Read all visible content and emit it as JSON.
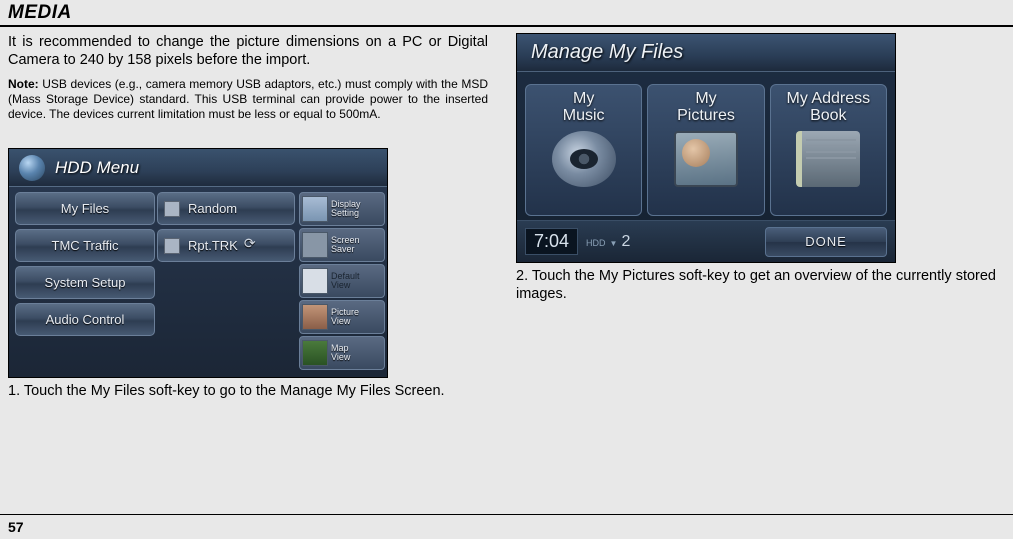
{
  "header": {
    "title": "MEDIA"
  },
  "col_left": {
    "intro": "It is recommended to change the picture dimensions on a PC or Digital Camera to 240 by 158 pixels before the import.",
    "note_label": "Note:",
    "note_body": " USB devices (e.g., camera memory USB adaptors, etc.) must comply with the MSD (Mass Storage Device) standard. This USB terminal can provide power to the inserted device. The devices current limitation must be less or equal to 500mA.",
    "caption": "1. Touch the My Files soft-key to go to the Manage My Files Screen."
  },
  "col_right": {
    "caption": "2. Touch the My Pictures soft-key to get an overview of the currently stored images."
  },
  "hdd_menu": {
    "title": "HDD Menu",
    "left_buttons": [
      "My Files",
      "TMC Traffic",
      "System Setup",
      "Audio Control"
    ],
    "mid_buttons": [
      "Random",
      "Rpt.TRK"
    ],
    "side_cards": [
      "Display\nSetting",
      "Screen\nSaver",
      "Default\nView",
      "Picture\nView",
      "Map\nView"
    ]
  },
  "manage_files": {
    "title": "Manage My Files",
    "cards": [
      "My\nMusic",
      "My\nPictures",
      "My Address\nBook"
    ],
    "clock": "7:04",
    "hdd_label": "HDD",
    "hdd_track": "2",
    "done": "DONE"
  },
  "page_number": "57"
}
